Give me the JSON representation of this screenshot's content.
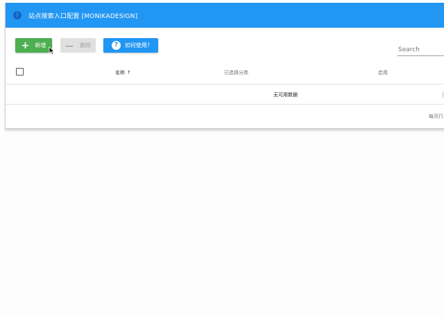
{
  "window": {
    "title": "站点搜索入口配置 [MONIKADESIGN]",
    "title_icon": "info-icon",
    "accent_color": "#2196f3"
  },
  "toolbar": {
    "add_label": "新增",
    "add_icon": "plus-icon",
    "add_color": "#4caf50",
    "delete_label": "删除",
    "delete_icon": "minus-icon",
    "help_label": "如何使用?",
    "help_icon": "question-circle-icon"
  },
  "search": {
    "placeholder": "Search",
    "value": ""
  },
  "table": {
    "columns": [
      {
        "label": "名称",
        "sort": "ascending"
      },
      {
        "label": "已选择分类"
      },
      {
        "label": "启用"
      }
    ],
    "sort_indicator": "↑",
    "empty_message": "无可用数据"
  },
  "footer": {
    "rows_per_page_label": "每页行"
  }
}
